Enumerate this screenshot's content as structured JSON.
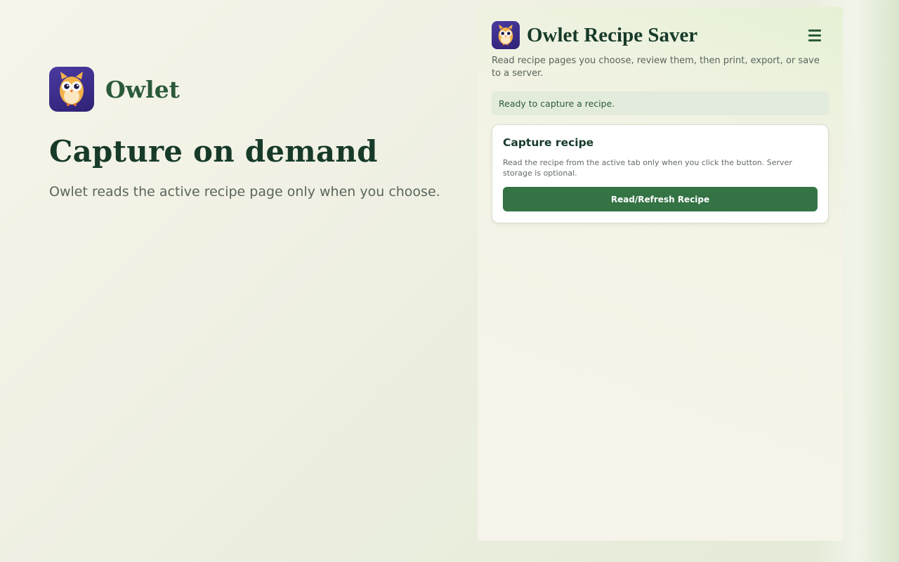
{
  "hero": {
    "brand_name": "Owlet",
    "logo_icon": "owl-logo-icon",
    "title": "Capture on demand",
    "subtitle": "Owlet reads the active recipe page only when you choose."
  },
  "panel": {
    "title": "Owlet Recipe Saver",
    "logo_icon": "owl-logo-icon",
    "menu_icon": "hamburger-menu-icon",
    "description": "Read recipe pages you choose, review them, then print, export, or save to a server.",
    "status": "Ready to capture a recipe.",
    "card": {
      "title": "Capture recipe",
      "text": "Read the recipe from the active tab only when you click the button. Server storage is optional.",
      "button_label": "Read/Refresh Recipe"
    }
  },
  "colors": {
    "accent_green": "#347344",
    "heading_green": "#173a29",
    "logo_purple": "#3d2f8c",
    "status_bg": "#e3ecdc"
  }
}
